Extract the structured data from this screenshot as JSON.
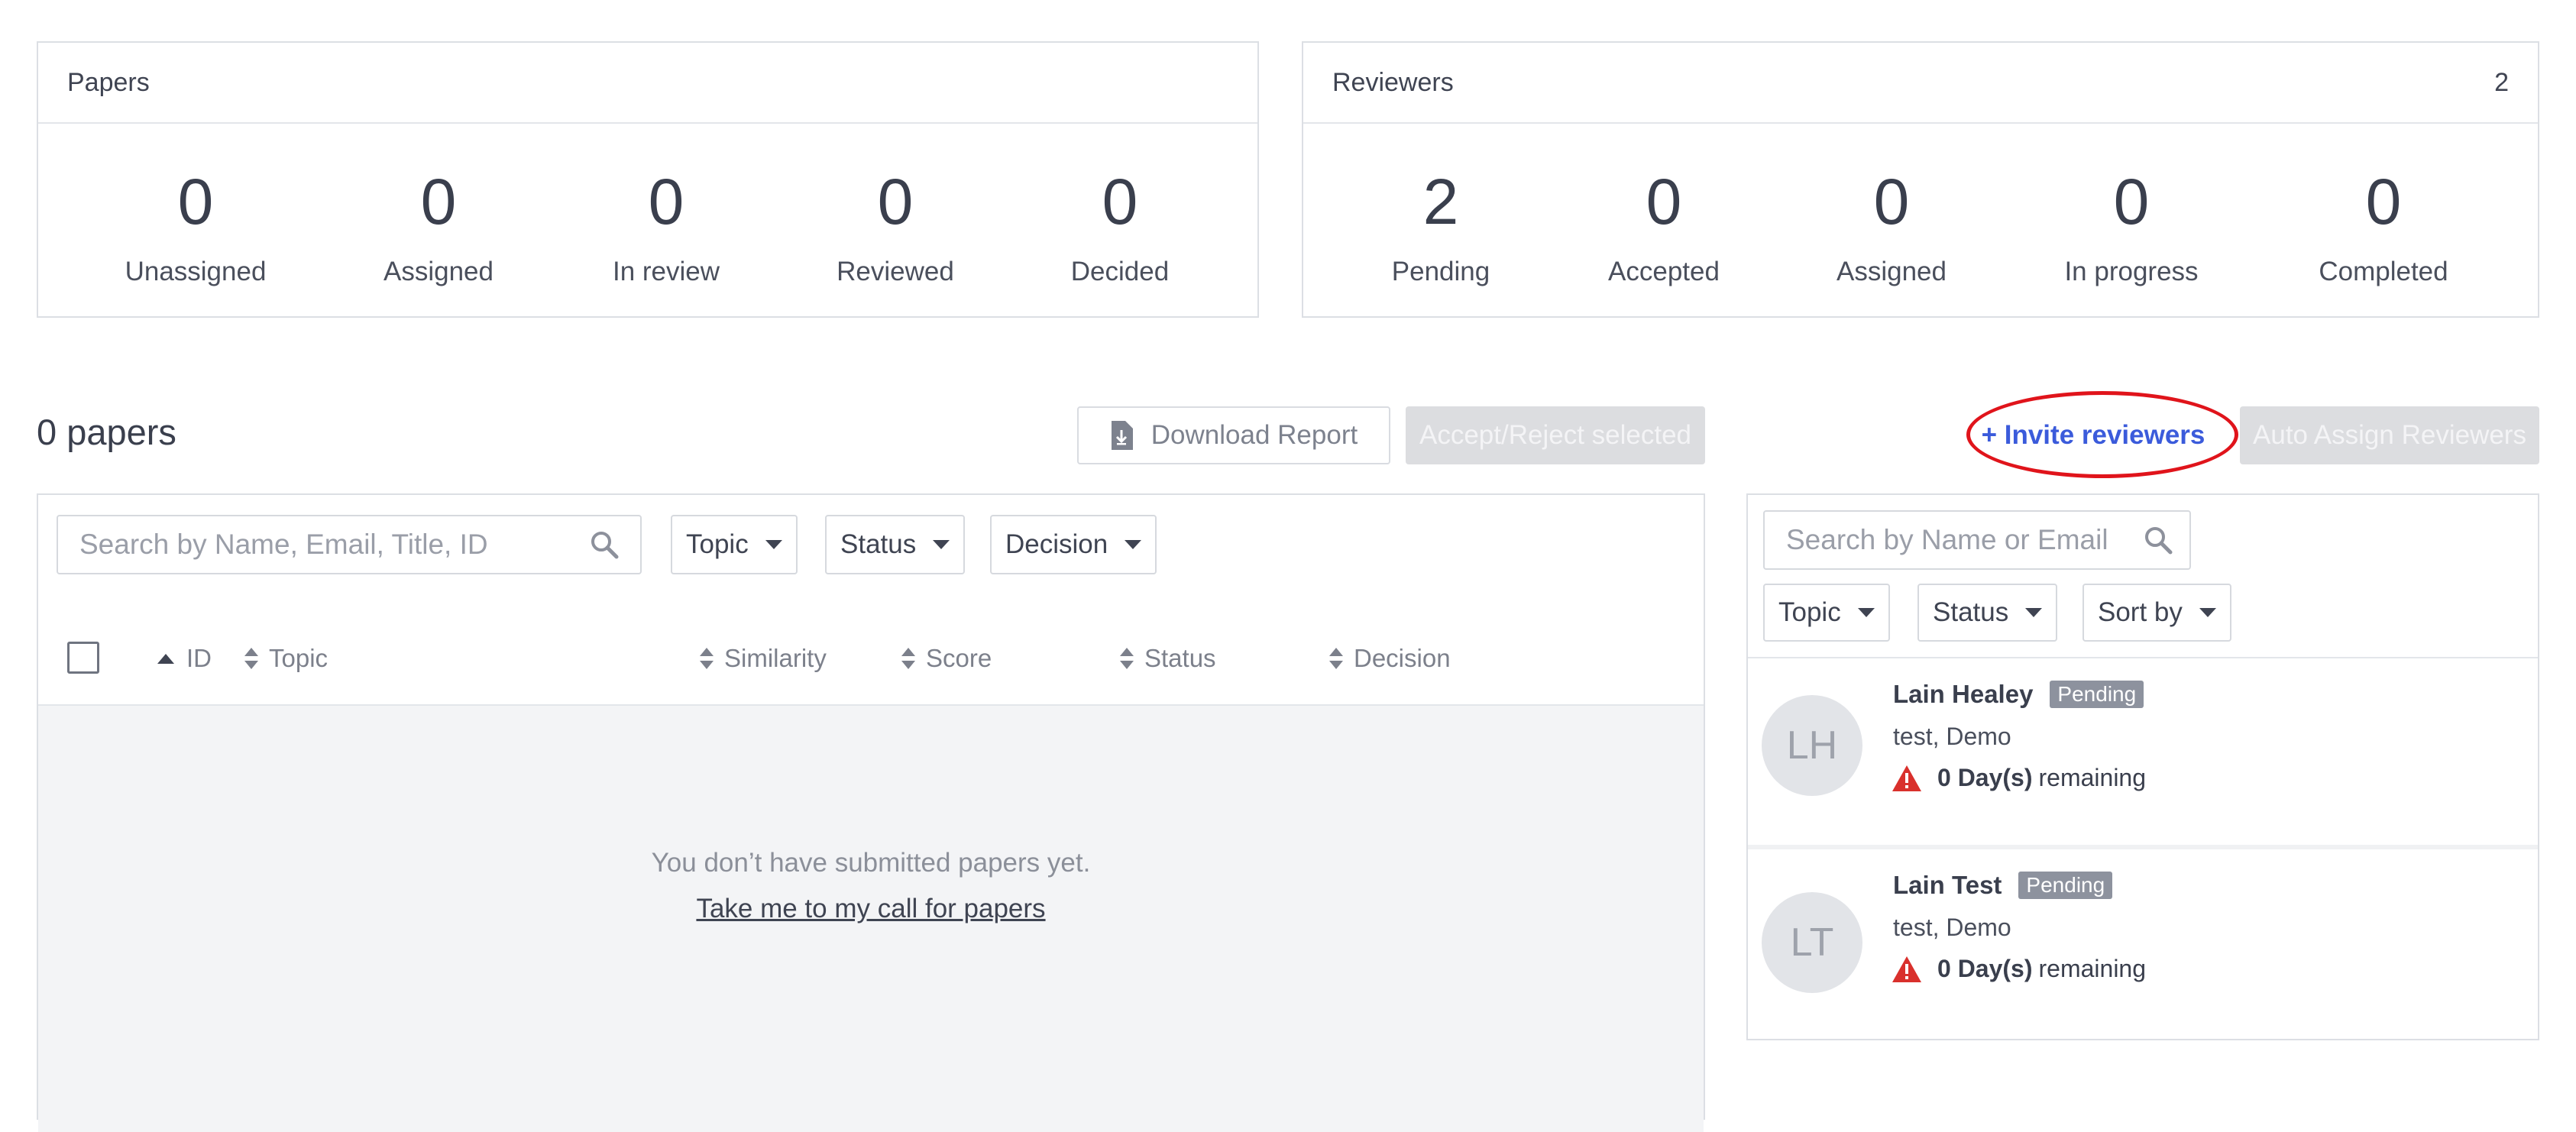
{
  "papers_card": {
    "title": "Papers",
    "stats": [
      {
        "value": "0",
        "label": "Unassigned"
      },
      {
        "value": "0",
        "label": "Assigned"
      },
      {
        "value": "0",
        "label": "In review"
      },
      {
        "value": "0",
        "label": "Reviewed"
      },
      {
        "value": "0",
        "label": "Decided"
      }
    ]
  },
  "reviewers_card": {
    "title": "Reviewers",
    "count": "2",
    "stats": [
      {
        "value": "2",
        "label": "Pending"
      },
      {
        "value": "0",
        "label": "Accepted"
      },
      {
        "value": "0",
        "label": "Assigned"
      },
      {
        "value": "0",
        "label": "In progress"
      },
      {
        "value": "0",
        "label": "Completed"
      }
    ]
  },
  "papers_section": {
    "count_label": "0 papers",
    "download_label": "Download Report",
    "accept_reject_label": "Accept/Reject selected",
    "search_placeholder": "Search by Name, Email, Title, ID",
    "filters": {
      "topic": "Topic",
      "status": "Status",
      "decision": "Decision"
    },
    "columns": {
      "id": "ID",
      "topic": "Topic",
      "similarity": "Similarity",
      "score": "Score",
      "status": "Status",
      "decision": "Decision"
    },
    "empty_message": "You don’t have submitted papers yet.",
    "empty_link": "Take me to my call for papers"
  },
  "reviewers_section": {
    "invite_label": "+ Invite reviewers",
    "auto_assign_label": "Auto Assign Reviewers",
    "search_placeholder": "Search by Name or Email",
    "filters": {
      "topic": "Topic",
      "status": "Status",
      "sort": "Sort by"
    },
    "reviewers": [
      {
        "initials": "LH",
        "name": "Lain Healey",
        "badge": "Pending",
        "topics": "test, Demo",
        "days": "0 Day(s)",
        "days_suffix": "remaining"
      },
      {
        "initials": "LT",
        "name": "Lain Test",
        "badge": "Pending",
        "topics": "test, Demo",
        "days": "0 Day(s)",
        "days_suffix": "remaining"
      }
    ]
  },
  "colors": {
    "accent": "#3b5bdb",
    "highlight_ring": "#e0141b",
    "warning": "#d9302c",
    "badge": "#8d929e"
  }
}
